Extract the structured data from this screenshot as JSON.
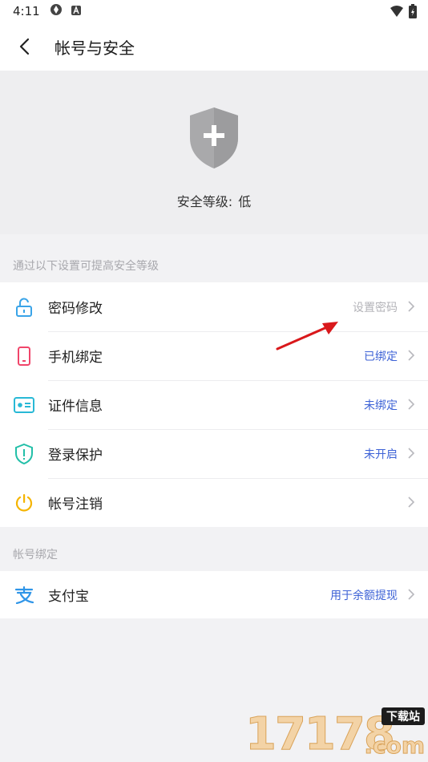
{
  "status_bar": {
    "time": "4:11"
  },
  "header": {
    "title": "帐号与安全"
  },
  "hero": {
    "level_label": "安全等级:",
    "level_value": "低"
  },
  "security_section": {
    "label": "通过以下设置可提高安全等级",
    "items": [
      {
        "icon": "unlock-icon",
        "label": "密码修改",
        "value": "设置密码",
        "value_color": "#b3b3b8"
      },
      {
        "icon": "phone-icon",
        "label": "手机绑定",
        "value": "已绑定",
        "value_color": "#3d62d6"
      },
      {
        "icon": "id-card-icon",
        "label": "证件信息",
        "value": "未绑定",
        "value_color": "#3d62d6"
      },
      {
        "icon": "shield-alert-icon",
        "label": "登录保护",
        "value": "未开启",
        "value_color": "#3d62d6"
      },
      {
        "icon": "power-icon",
        "label": "帐号注销",
        "value": ""
      }
    ]
  },
  "binding_section": {
    "label": "帐号绑定",
    "items": [
      {
        "icon": "alipay-icon",
        "label": "支付宝",
        "value": "用于余额提现",
        "value_color": "#3d62d6"
      }
    ]
  },
  "watermark": {
    "number": "17178",
    "tag": "下载站",
    "suffix": ".com"
  },
  "colors": {
    "accent_blue": "#3d62d6",
    "muted_gray": "#b3b3b8",
    "background": "#f2f2f4"
  }
}
